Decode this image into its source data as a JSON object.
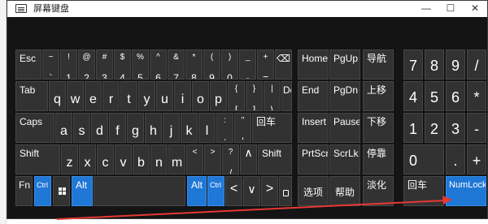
{
  "window": {
    "title": "屏幕键盘",
    "minimize": "—",
    "maximize": "☐",
    "close": "✕"
  },
  "keys": {
    "esc": "Esc",
    "backtick": {
      "top": "~",
      "bottom": "`"
    },
    "d1": {
      "top": "!",
      "bottom": "1"
    },
    "d2": {
      "top": "@",
      "bottom": "2"
    },
    "d3": {
      "top": "#",
      "bottom": "3"
    },
    "d4": {
      "top": "$",
      "bottom": "4"
    },
    "d5": {
      "top": "%",
      "bottom": "5"
    },
    "d6": {
      "top": "^",
      "bottom": "6"
    },
    "d7": {
      "top": "&",
      "bottom": "7"
    },
    "d8": {
      "top": "*",
      "bottom": "8"
    },
    "d9": {
      "top": "(",
      "bottom": "9"
    },
    "d0": {
      "top": ")",
      "bottom": "0"
    },
    "minus": {
      "top": "_",
      "bottom": "-"
    },
    "equals": {
      "top": "+",
      "bottom": "="
    },
    "backspace": "⌫",
    "home": "Home",
    "pgup": "PgUp",
    "nav": "导航",
    "np7": "7",
    "np8": "8",
    "np9": "9",
    "np_div": "/",
    "tab": "Tab",
    "q": "q",
    "w": "w",
    "e": "e",
    "r": "r",
    "t": "t",
    "y": "y",
    "u": "u",
    "i": "i",
    "o": "o",
    "p": "p",
    "lbracket": {
      "top": "{",
      "bottom": "["
    },
    "rbracket": {
      "top": "}",
      "bottom": "]"
    },
    "backslash": {
      "top": "|",
      "bottom": "\\"
    },
    "del": "Del",
    "end": "End",
    "pgdn": "PgDn",
    "moveup": "上移",
    "np4": "4",
    "np5": "5",
    "np6": "6",
    "np_mul": "*",
    "caps": "Caps",
    "a": "a",
    "s": "s",
    "d": "d",
    "f": "f",
    "g": "g",
    "h": "h",
    "j": "j",
    "k": "k",
    "l": "l",
    "semicolon": {
      "top": ":",
      "bottom": ";"
    },
    "quote": {
      "top": "\"",
      "bottom": "'"
    },
    "enter": "回车",
    "insert": "Insert",
    "pause": "Pause",
    "movedown": "下移",
    "np1": "1",
    "np2": "2",
    "np3": "3",
    "np_minus": "-",
    "shift_l": "Shift",
    "z": "z",
    "x": "x",
    "c": "c",
    "v": "v",
    "b": "b",
    "n": "n",
    "m": "m",
    "comma": {
      "top": "<",
      "bottom": ","
    },
    "period": {
      "top": ">",
      "bottom": "."
    },
    "slash": {
      "top": "?",
      "bottom": "/"
    },
    "up": "∧",
    "shift_r": "Shift",
    "prtscn": "PrtScn",
    "scrlk": "ScrLk",
    "dock": "停靠",
    "np0": "0",
    "np_dot": ".",
    "np_plus": "+",
    "fn": "Fn",
    "ctrl_l": "Ctrl",
    "alt_l": "Alt",
    "alt_r": "Alt",
    "ctrl_r": "Ctrl",
    "left": "<",
    "down": "∨",
    "right": ">",
    "options": "选项",
    "help": "帮助",
    "fade": "淡化",
    "np_enter": "回车",
    "numlock": "NumLock"
  },
  "annotation": {
    "arrow_color": "#e53935"
  }
}
